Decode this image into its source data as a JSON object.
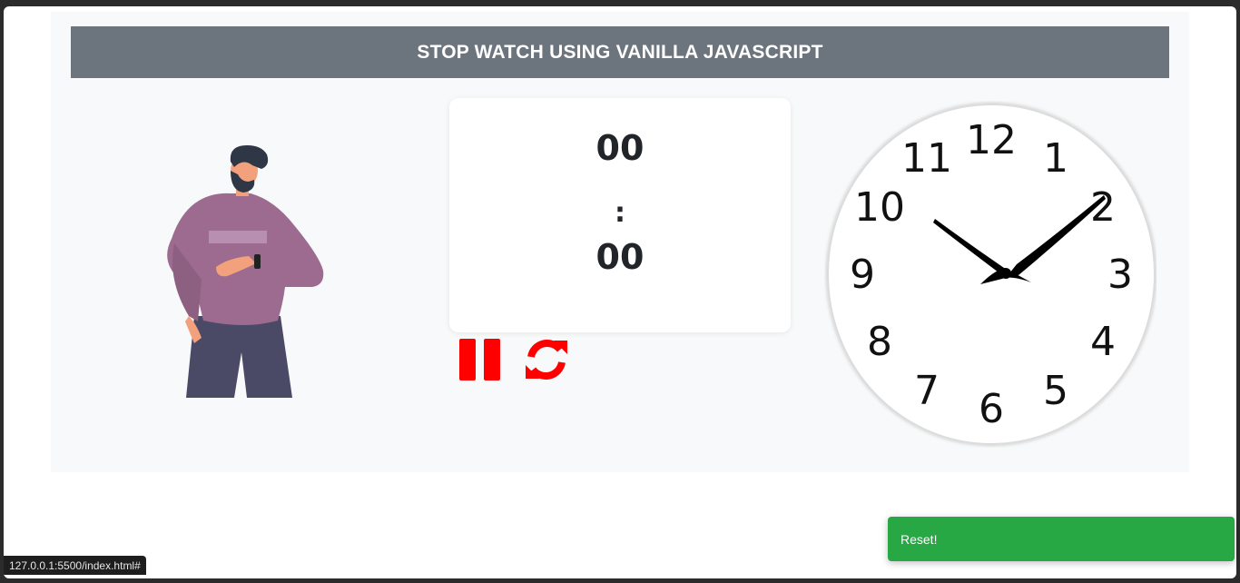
{
  "header": {
    "title": "STOP WATCH USING VANILLA JAVASCRIPT"
  },
  "stopwatch": {
    "minutes": "00",
    "separator": ":",
    "seconds": "00"
  },
  "controls": {
    "pause_icon": "pause-icon",
    "reset_icon": "sync-icon",
    "color": "#ff0000"
  },
  "illustration": {
    "person": "man-checking-watch-illustration"
  },
  "clock": {
    "numerals": [
      "12",
      "1",
      "2",
      "3",
      "4",
      "5",
      "6",
      "7",
      "8",
      "9",
      "10",
      "11"
    ],
    "hour_hand_points_to": "10",
    "minute_hand_points_to": "2"
  },
  "status_bar": {
    "url": "127.0.0.1:5500/index.html#"
  },
  "toast": {
    "message": "Reset!",
    "color": "#28a745"
  },
  "colors": {
    "header_bg": "#6c757d",
    "page_bg": "#f8f9fa"
  }
}
